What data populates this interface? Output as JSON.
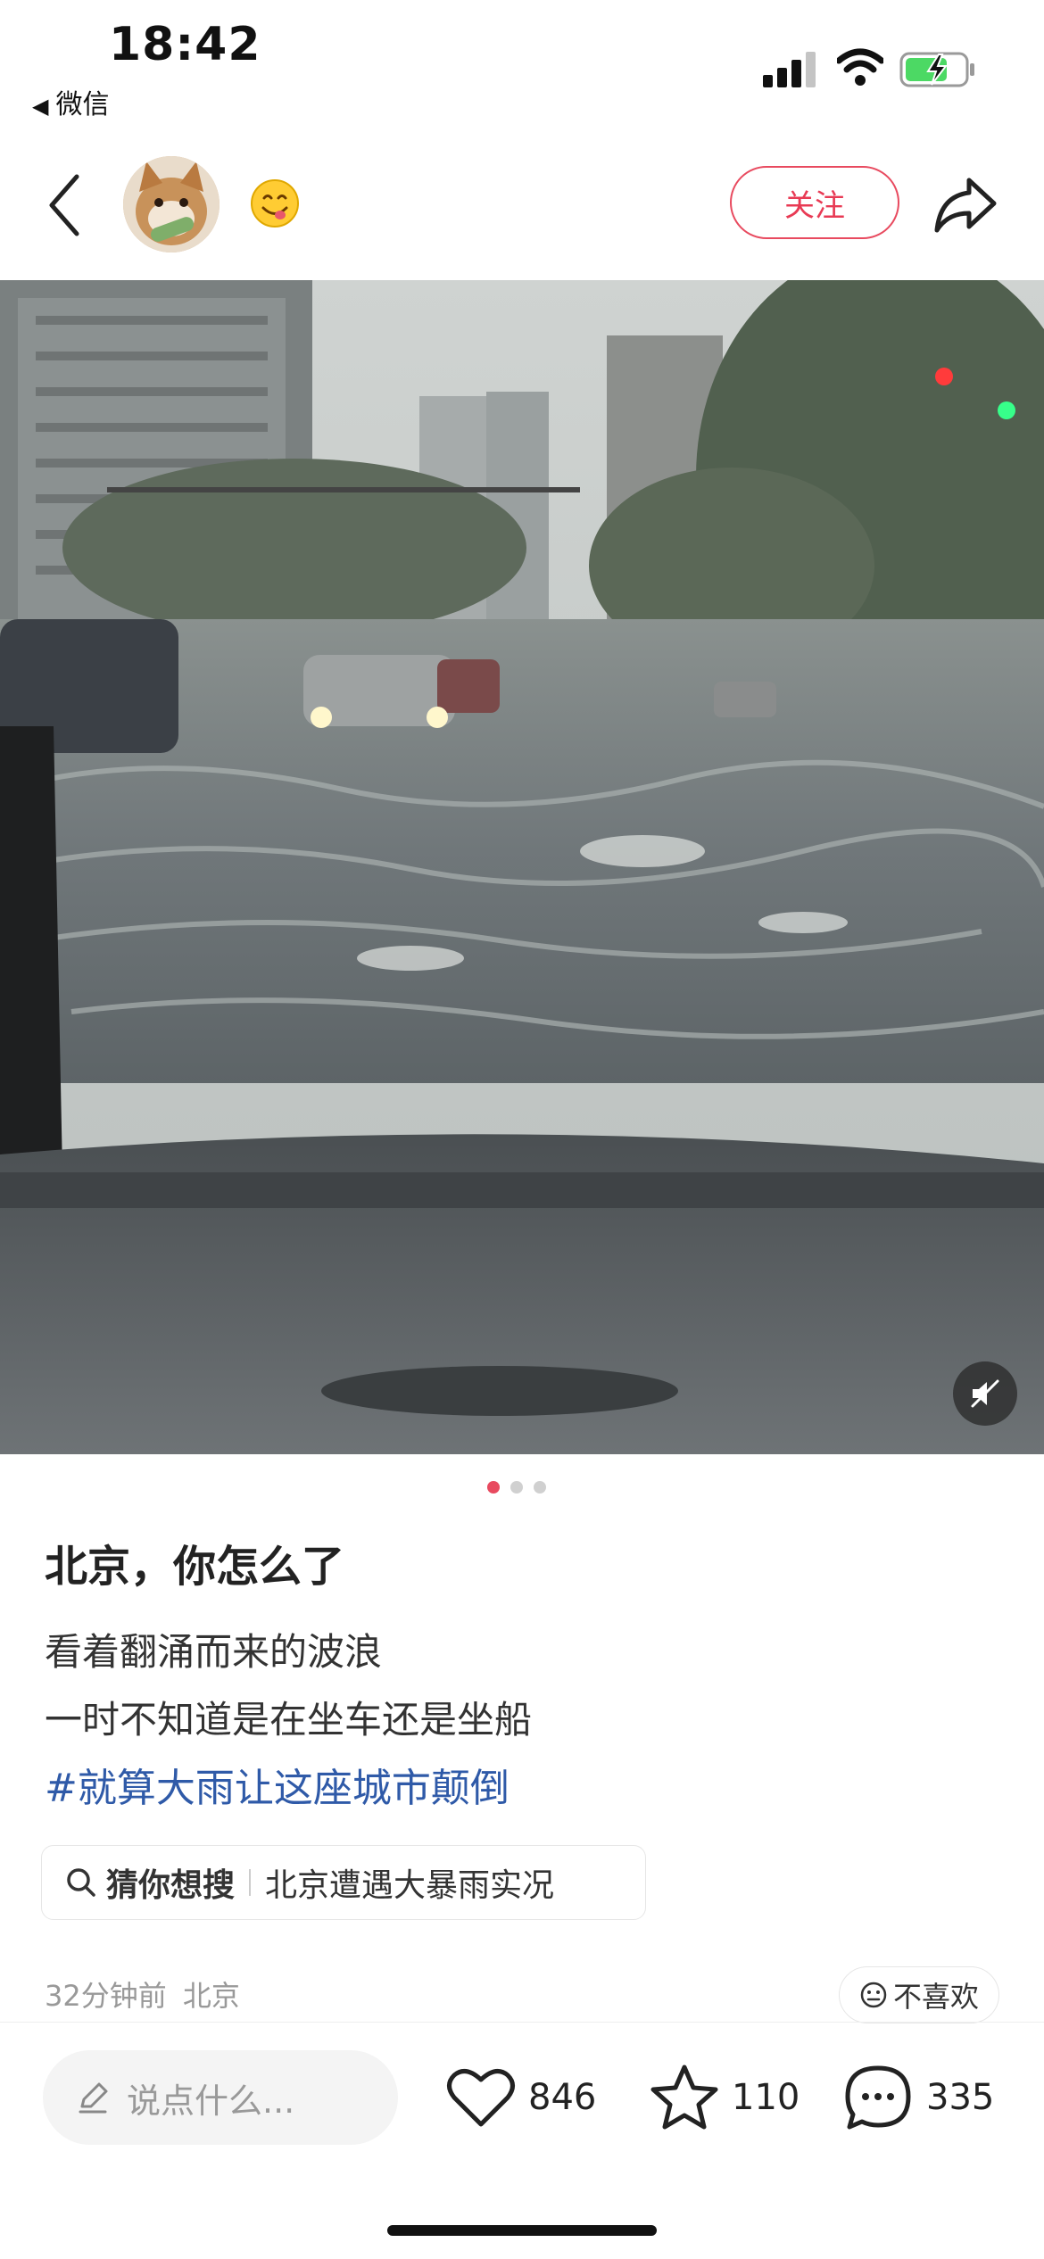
{
  "status_bar": {
    "time": "18:42",
    "back_app": "微信",
    "icons": [
      "signal-icon",
      "wifi-icon",
      "battery-charging-icon"
    ]
  },
  "header": {
    "follow_label": "关注",
    "avatar_icon": "cat-avatar",
    "emoji_icon": "smiling-emoji-icon"
  },
  "post": {
    "title": "北京，你怎么了",
    "lines": [
      "看着翻涌而来的波浪",
      "一时不知道是在坐车还是坐船"
    ],
    "hashtag": "#就算大雨让这座城市颠倒",
    "image_page": {
      "current": 1,
      "total": 3
    },
    "search_hint": {
      "label": "猜你想搜",
      "query": "北京遭遇大暴雨实况"
    },
    "time_ago": "32分钟前",
    "location": "北京",
    "dislike_label": "不喜欢"
  },
  "bottom_bar": {
    "comment_placeholder": "说点什么...",
    "likes": "846",
    "collects": "110",
    "comments": "335"
  },
  "colors": {
    "accent": "#e84a5f",
    "hashtag": "#2f5aa8",
    "muted": "#999999"
  }
}
